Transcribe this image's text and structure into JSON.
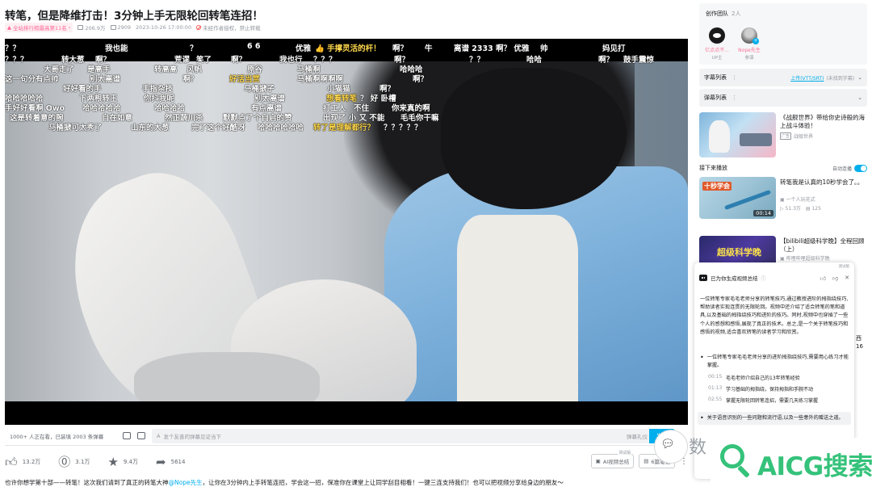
{
  "header": {
    "title": "转笔，但是降维打击！3分钟上手无限轮回转笔连招！",
    "rank": "全站排行榜最高第11名",
    "plays": "206.9万",
    "danmaku_count": "2909",
    "datetime": "2023-10-26 17:00:00",
    "copyright": "未经作者授权，禁止转载"
  },
  "danmaku": [
    {
      "text": "？？",
      "color": "#ffffff"
    },
    {
      "text": "我也能",
      "color": "#ffffff"
    },
    {
      "text": "？",
      "color": "#ffffff"
    },
    {
      "text": "6 6",
      "color": "#ffffff"
    },
    {
      "text": "优雅",
      "color": "#ffffff"
    },
    {
      "text": "👍 手撑灵活的杆！",
      "color": "#ffd84d"
    },
    {
      "text": "啊？",
      "color": "#ffffff"
    },
    {
      "text": "牛",
      "color": "#ffffff"
    },
    {
      "text": "离谱 2333 啊？ 优雅",
      "color": "#ffffff"
    },
    {
      "text": "帅",
      "color": "#ffffff"
    },
    {
      "text": "妈见打",
      "color": "#ffffff"
    },
    {
      "text": "？？？",
      "color": "#ffffff"
    },
    {
      "text": "转大葱",
      "color": "#ffffff"
    },
    {
      "text": "啊？",
      "color": "#ffffff"
    },
    {
      "text": "荒谬",
      "color": "#ffffff"
    },
    {
      "text": "笑了",
      "color": "#ffffff"
    },
    {
      "text": "啊？",
      "color": "#ffffff"
    },
    {
      "text": "我也行",
      "color": "#ffffff"
    },
    {
      "text": "？？？",
      "color": "#ffffff"
    },
    {
      "text": "啊？",
      "color": "#ffffff"
    },
    {
      "text": "？？",
      "color": "#ffffff"
    },
    {
      "text": "哈哈",
      "color": "#ffffff"
    },
    {
      "text": "啊？",
      "color": "#ffffff"
    },
    {
      "text": "鼓手震惊",
      "color": "#ffffff"
    },
    {
      "text": "大哥走了",
      "color": "#ffffff"
    },
    {
      "text": "是高手",
      "color": "#ffffff"
    },
    {
      "text": "转高高",
      "color": "#ffffff"
    },
    {
      "text": "风帆",
      "color": "#ffffff"
    },
    {
      "text": "原谷",
      "color": "#ffffff"
    },
    {
      "text": "马桶啊",
      "color": "#ffffff"
    },
    {
      "text": "哈哈哈",
      "color": "#ffffff"
    },
    {
      "text": "这一句分有点帅",
      "color": "#ffffff"
    },
    {
      "text": "别太离谱",
      "color": "#ffffff"
    },
    {
      "text": "啊？",
      "color": "#ffffff"
    },
    {
      "text": "好活当赏",
      "color": "#ffd84d"
    },
    {
      "text": "马桶啊啊啊啊",
      "color": "#ffffff"
    },
    {
      "text": "啊？",
      "color": "#ffffff"
    },
    {
      "text": "好好看的手",
      "color": "#ffffff"
    },
    {
      "text": "手指杂技",
      "color": "#ffffff"
    },
    {
      "text": "马桶搋子",
      "color": "#ffffff"
    },
    {
      "text": "小猫猫",
      "color": "#ffffff"
    },
    {
      "text": "啊？",
      "color": "#ffffff"
    },
    {
      "text": "哈哈哈哈哈",
      "color": "#ffffff"
    },
    {
      "text": "下两根转王",
      "color": "#ffffff"
    },
    {
      "text": "你抖我呢",
      "color": "#ffffff"
    },
    {
      "text": "别太离谱",
      "color": "#ffffff"
    },
    {
      "text": "想看转笔",
      "color": "#ffd84d"
    },
    {
      "text": "？ 好 卧槽",
      "color": "#ffffff"
    },
    {
      "text": "手好好看啊 Owo",
      "color": "#ffffff"
    },
    {
      "text": "哈哈哈哈哈",
      "color": "#ffffff"
    },
    {
      "text": "哈哈哈哈",
      "color": "#ffffff"
    },
    {
      "text": "有点离谱",
      "color": "#ffffff"
    },
    {
      "text": "打工人",
      "color": "#ffffff"
    },
    {
      "text": "不住",
      "color": "#ffffff"
    },
    {
      "text": "你来真的啊",
      "color": "#ffffff"
    },
    {
      "text": "这是转着意的腕",
      "color": "#ffffff"
    },
    {
      "text": "自在如意",
      "color": "#ffffff"
    },
    {
      "text": "然正蔬川杀",
      "color": "#ffffff"
    },
    {
      "text": "默默点了个自启的赞",
      "color": "#ffffff"
    },
    {
      "text": "出现了 小 又 不能",
      "color": "#ffffff"
    },
    {
      "text": "毛毛你干嘛",
      "color": "#ffffff"
    },
    {
      "text": "马桶搋可太秀了",
      "color": "#ffffff"
    },
    {
      "text": "山东的大葱",
      "color": "#ffffff"
    },
    {
      "text": "完了这个好酷呀",
      "color": "#ffffff"
    },
    {
      "text": "哈哈哈哈哈哈",
      "color": "#ffffff"
    },
    {
      "text": "转了是理解都行？",
      "color": "#ffd84d"
    },
    {
      "text": "？？？？？",
      "color": "#ffffff"
    }
  ],
  "send_bar": {
    "viewers": "1000+ 人正在看，已装填 2003 条弹幕",
    "placeholder": "发个友善的弹幕见证当下",
    "rule": "弹幕礼仪",
    "send": "发送"
  },
  "toolbar": {
    "like": "13.2万",
    "coin": "3.1万",
    "favorite": "9.4万",
    "share": "5614",
    "ai_summary": "AI视频总结",
    "ai_tag": "测试版",
    "notes": "6篇笔记",
    "more": "⋮"
  },
  "description": {
    "prefix": "也许你想学第十部——转笔！这次我们请到了真正的转笔大神",
    "mention": "@Nope先生",
    "suffix": "，让你在3分钟内上手转笔连招，学会这一招，保准你在课堂上让同学刮目相看！一键三连支持我们！也可以把视频分享给身边的朋友～"
  },
  "sidebar": {
    "team_title": "创作团队",
    "team_count": "2人",
    "creators": [
      {
        "name": "亿点点不...",
        "role": "UP主"
      },
      {
        "name": "Nope先生",
        "role": "参演"
      }
    ],
    "subtitle_panel": "字幕列表",
    "subtitle_upload": "上传(VTT/SRT)",
    "subtitle_note": "(未找到字幕)",
    "danmaku_panel": "弹幕列表",
    "ad": {
      "title": "《战舰世界》带给你史诗般的海上战斗体验！",
      "tag": "广告",
      "source": "战舰世界"
    },
    "next_label": "接下来播放",
    "autoplay_label": "自动连播",
    "recs": [
      {
        "title": "转笔我是认真的10秒学会了。。",
        "thumb_text": "十秒学会",
        "duration": "00:14",
        "up": "一个人玩花式",
        "plays": "51.3万",
        "danmaku": "125"
      },
      {
        "title": "【bilibili超级科学晚】全程回顾（上）",
        "thumb_text": "超级科学晚",
        "up": "哔哩哔哩超级科学晚"
      }
    ],
    "cut_texts": [
      "西",
      "16"
    ]
  },
  "ai_popup": {
    "badge": "测试版",
    "title": "已为你生成视频总结",
    "summary": "一位转笔专家毛毛老师分享的转笔技巧,通过教授进阶的拇指绕技巧,帮助读者实现连贯的无限轮回。视频中还介绍了适合转笔的笔和道具,以及基础的拇指绕技巧和进阶的技巧。同时,视频中也穿插了一些个人的感想和感悟,展现了真正的技术。总之,是一个关于转笔技巧和感悟的视频,适合喜欢转笔的读者学习和欣赏。",
    "point1": "一位转笔专家毛毛老师分享的进阶拇指绕技巧,需要用心练习才能掌握。",
    "timestamps": [
      {
        "time": "00:15",
        "text": "毛毛老师介绍自己的13年转笔经验"
      },
      {
        "time": "01:13",
        "text": "学习基础的拇指绕，保持拇指和手腕不动"
      },
      {
        "time": "02:55",
        "text": "掌握无限轮回转笔连招，需要几天练习掌握"
      }
    ],
    "point2": "关于语音识别的一些问题和流行语,以及一些意外的赠送之道。"
  },
  "watermark": {
    "shu": "数",
    "brand": "AICG搜索"
  }
}
